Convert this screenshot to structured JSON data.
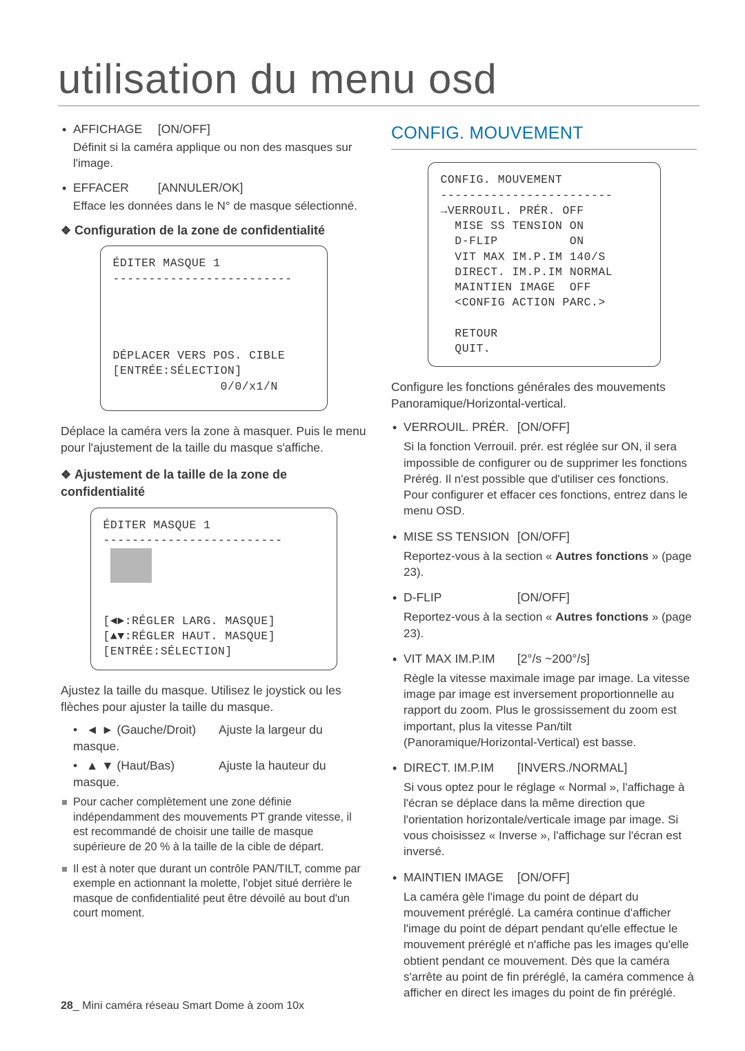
{
  "page_title": "utilisation du menu osd",
  "left": {
    "items": [
      {
        "name": "AFFICHAGE",
        "value": "[ON/OFF]",
        "desc": "Définit si la caméra applique ou non des masques sur l'image."
      },
      {
        "name": "EFFACER",
        "value": "[ANNULER/OK]",
        "desc": "Efface les données dans le N° de masque sélectionné."
      }
    ],
    "section1_title": "Configuration de la zone de confidentialité",
    "osd1": {
      "title": "ÉDITER MASQUE 1",
      "sep": "-------------------------",
      "line1": "DÉPLACER VERS POS. CIBLE",
      "line2": "[ENTRÉE:SÉLECTION]",
      "line3": "               0/0/x1/N"
    },
    "osd1_desc": "Déplace la caméra vers la zone à masquer. Puis le menu pour l'ajustement de la taille du masque s'affiche.",
    "section2_title": "Ajustement de la taille de la zone de confidentialité",
    "osd2": {
      "title": "ÉDITER MASQUE 1",
      "sep": "-------------------------",
      "l1": "[◄►:RÉGLER LARG. MASQUE]",
      "l2": "[▲▼:RÉGLER HAUT. MASQUE]",
      "l3": "[ENTRÉE:SÉLECTION]"
    },
    "osd2_desc": "Ajustez la taille du masque. Utilisez le joystick ou les flèches pour ajuster la taille du masque.",
    "controls": [
      {
        "keys": "◄ ► (Gauche/Droit)",
        "does": "Ajuste la largeur du masque."
      },
      {
        "keys": "▲ ▼ (Haut/Bas)",
        "does": "Ajuste la hauteur du masque."
      }
    ],
    "notes": [
      "Pour cacher complètement une zone définie indépendamment des mouvements PT grande vitesse, il est recommandé de choisir une taille de masque supérieure de 20 % à la taille de la cible de départ.",
      "Il est à noter que durant un contrôle PAN/TILT, comme par exemple en actionnant la molette, l'objet situé derrière le masque de confidentialité peut être dévoilé au bout d'un court moment."
    ]
  },
  "right": {
    "heading": "CONFIG. MOUVEMENT",
    "osd": {
      "title": "CONFIG. MOUVEMENT",
      "sep": "------------------------",
      "rows": [
        "→VERROUIL. PRÉR. OFF",
        "  MISE SS TENSION ON",
        "  D-FLIP          ON",
        "  VIT MAX IM.P.IM 140/S",
        "  DIRECT. IM.P.IM NORMAL",
        "  MAINTIEN IMAGE  OFF",
        "  <CONFIG ACTION PARC.>",
        "",
        "  RETOUR",
        "  QUIT."
      ]
    },
    "intro": "Configure les fonctions générales des mouvements Panoramique/Horizontal-vertical.",
    "items": [
      {
        "name": "VERROUIL. PRÉR.",
        "value": "[ON/OFF]",
        "desc": "Si la fonction Verrouil. prér. est réglée sur ON, il sera impossible de configurer ou de supprimer les fonctions Prérég. Il n'est possible que d'utiliser ces fonctions. Pour configurer et effacer ces fonctions, entrez dans le menu OSD."
      },
      {
        "name": "MISE SS TENSION",
        "value": "[ON/OFF]",
        "desc_ref": "Reportez-vous à la section « ",
        "bold": "Autres fonctions",
        "desc_after": " » (page 23)."
      },
      {
        "name": "D-FLIP",
        "value": "[ON/OFF]",
        "desc_ref": "Reportez-vous à la section « ",
        "bold": "Autres fonctions",
        "desc_after": " » (page 23)."
      },
      {
        "name": "VIT MAX IM.P.IM",
        "value": "[2°/s ~200°/s]",
        "desc": "Règle la vitesse maximale image par image. La vitesse image par image est inversement proportionnelle au rapport du zoom. Plus le grossissement du zoom est important, plus la vitesse Pan/tilt (Panoramique/Horizontal-Vertical) est basse."
      },
      {
        "name": "DIRECT. IM.P.IM",
        "value": "[INVERS./NORMAL]",
        "desc": "Si vous optez pour le réglage « Normal », l'affichage à l'écran se déplace dans la même direction que l'orientation horizontale/verticale image par image. Si vous choisissez « Inverse », l'affichage sur l'écran est inversé."
      },
      {
        "name": "MAINTIEN IMAGE",
        "value": "[ON/OFF]",
        "desc": "La caméra gèle l'image du point de départ du mouvement préréglé. La caméra continue d'afficher l'image du point de départ pendant qu'elle effectue le mouvement préréglé et n'affiche pas les images qu'elle obtient pendant ce mouvement. Dès que la caméra s'arrête au point de fin préréglé, la caméra commence à afficher en direct les images du point de fin préréglé."
      }
    ]
  },
  "footer": {
    "page": "28",
    "sep": "_",
    "text": "Mini caméra réseau Smart Dome à zoom 10x"
  }
}
